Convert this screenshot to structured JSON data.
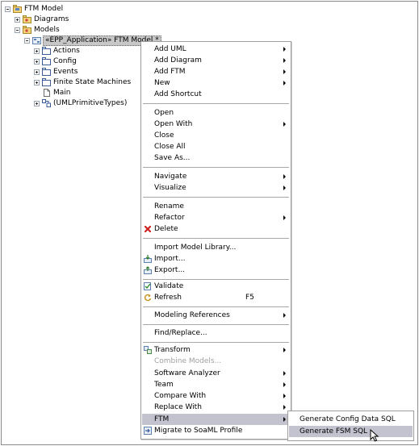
{
  "tree": {
    "root": "FTM Model",
    "diagrams": "Diagrams",
    "models": "Models",
    "selected_model": "«EPP_Application» FTM Model *",
    "children": [
      "Actions",
      "Config",
      "Events",
      "Finite State Machines",
      "Main",
      "(UMLPrimitiveTypes)"
    ]
  },
  "context_menu": {
    "items": [
      "Add UML",
      "Add Diagram",
      "Add FTM",
      "New",
      "Add Shortcut",
      "Open",
      "Open With",
      "Close",
      "Close All",
      "Save As...",
      "Navigate",
      "Visualize",
      "Rename",
      "Refactor",
      "Delete",
      "Import Model Library...",
      "Import...",
      "Export...",
      "Validate",
      "Refresh",
      "Modeling References",
      "Find/Replace...",
      "Transform",
      "Combine Models...",
      "Software Analyzer",
      "Team",
      "Compare With",
      "Replace With",
      "FTM",
      "Migrate to SoaML Profile"
    ],
    "refresh_accel": "F5"
  },
  "submenu": {
    "items": [
      "Generate Config Data SQL",
      "Generate FSM SQL"
    ]
  },
  "colors": {
    "highlight": "#c3c3d0",
    "disabled_text": "#a0a0a0",
    "delete_red": "#cc2222"
  }
}
